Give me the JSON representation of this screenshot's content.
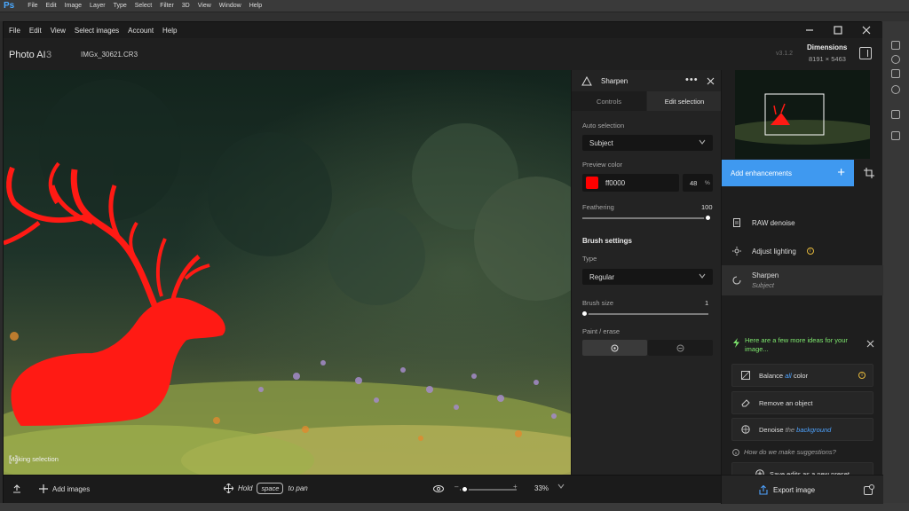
{
  "ps": {
    "logo": "Ps",
    "menu": [
      "File",
      "Edit",
      "Image",
      "Layer",
      "Type",
      "Select",
      "Filter",
      "3D",
      "View",
      "Window",
      "Help"
    ]
  },
  "app": {
    "menu": [
      "File",
      "Edit",
      "View",
      "Select images",
      "Account",
      "Help"
    ],
    "title": "Photo AI",
    "version_number": "3",
    "file_name": "IMGx_30621.CR3",
    "version_label": "v3.1.2",
    "dimensions_title": "Dimensions",
    "dimensions_value": "8191 × 5463"
  },
  "canvas": {
    "making_selection": "Making selection",
    "mask_color": "#ff0000"
  },
  "bottom": {
    "add_images": "Add images",
    "hold": "Hold",
    "space_key": "space",
    "to_pan": "to pan",
    "zoom": "33%",
    "zoom_fraction": 0.08
  },
  "selection_panel": {
    "title": "Sharpen",
    "tabs": [
      "Controls",
      "Edit selection"
    ],
    "auto_selection_label": "Auto selection",
    "auto_selection_value": "Subject",
    "preview_color_label": "Preview color",
    "preview_color_hex": "ff0000",
    "preview_color_swatch": "#ff0000",
    "opacity_value": "48",
    "opacity_unit": "%",
    "feathering_label": "Feathering",
    "feathering_value": "100",
    "brush_settings_label": "Brush settings",
    "type_label": "Type",
    "type_value": "Regular",
    "brush_size_label": "Brush size",
    "brush_size_value": "1",
    "paint_erase_label": "Paint / erase"
  },
  "right_panel": {
    "add_enhancements": "Add enhancements",
    "enhancements": [
      {
        "label": "RAW denoise",
        "sub": ""
      },
      {
        "label": "Adjust lighting",
        "sub": ""
      },
      {
        "label": "Sharpen",
        "sub": "Subject"
      }
    ],
    "ideas_text": "Here are a few more ideas for your image...",
    "ideas": {
      "balance": "Balance",
      "balance_all": "all",
      "balance_color": "color",
      "remove": "Remove an object",
      "denoise": "Denoise",
      "denoise_the": "the",
      "denoise_background": "background"
    },
    "how_suggest": "How do we make suggestions?",
    "save_preset": "Save edits as a new preset",
    "export": "Export image",
    "accent": "#3f99f0"
  }
}
